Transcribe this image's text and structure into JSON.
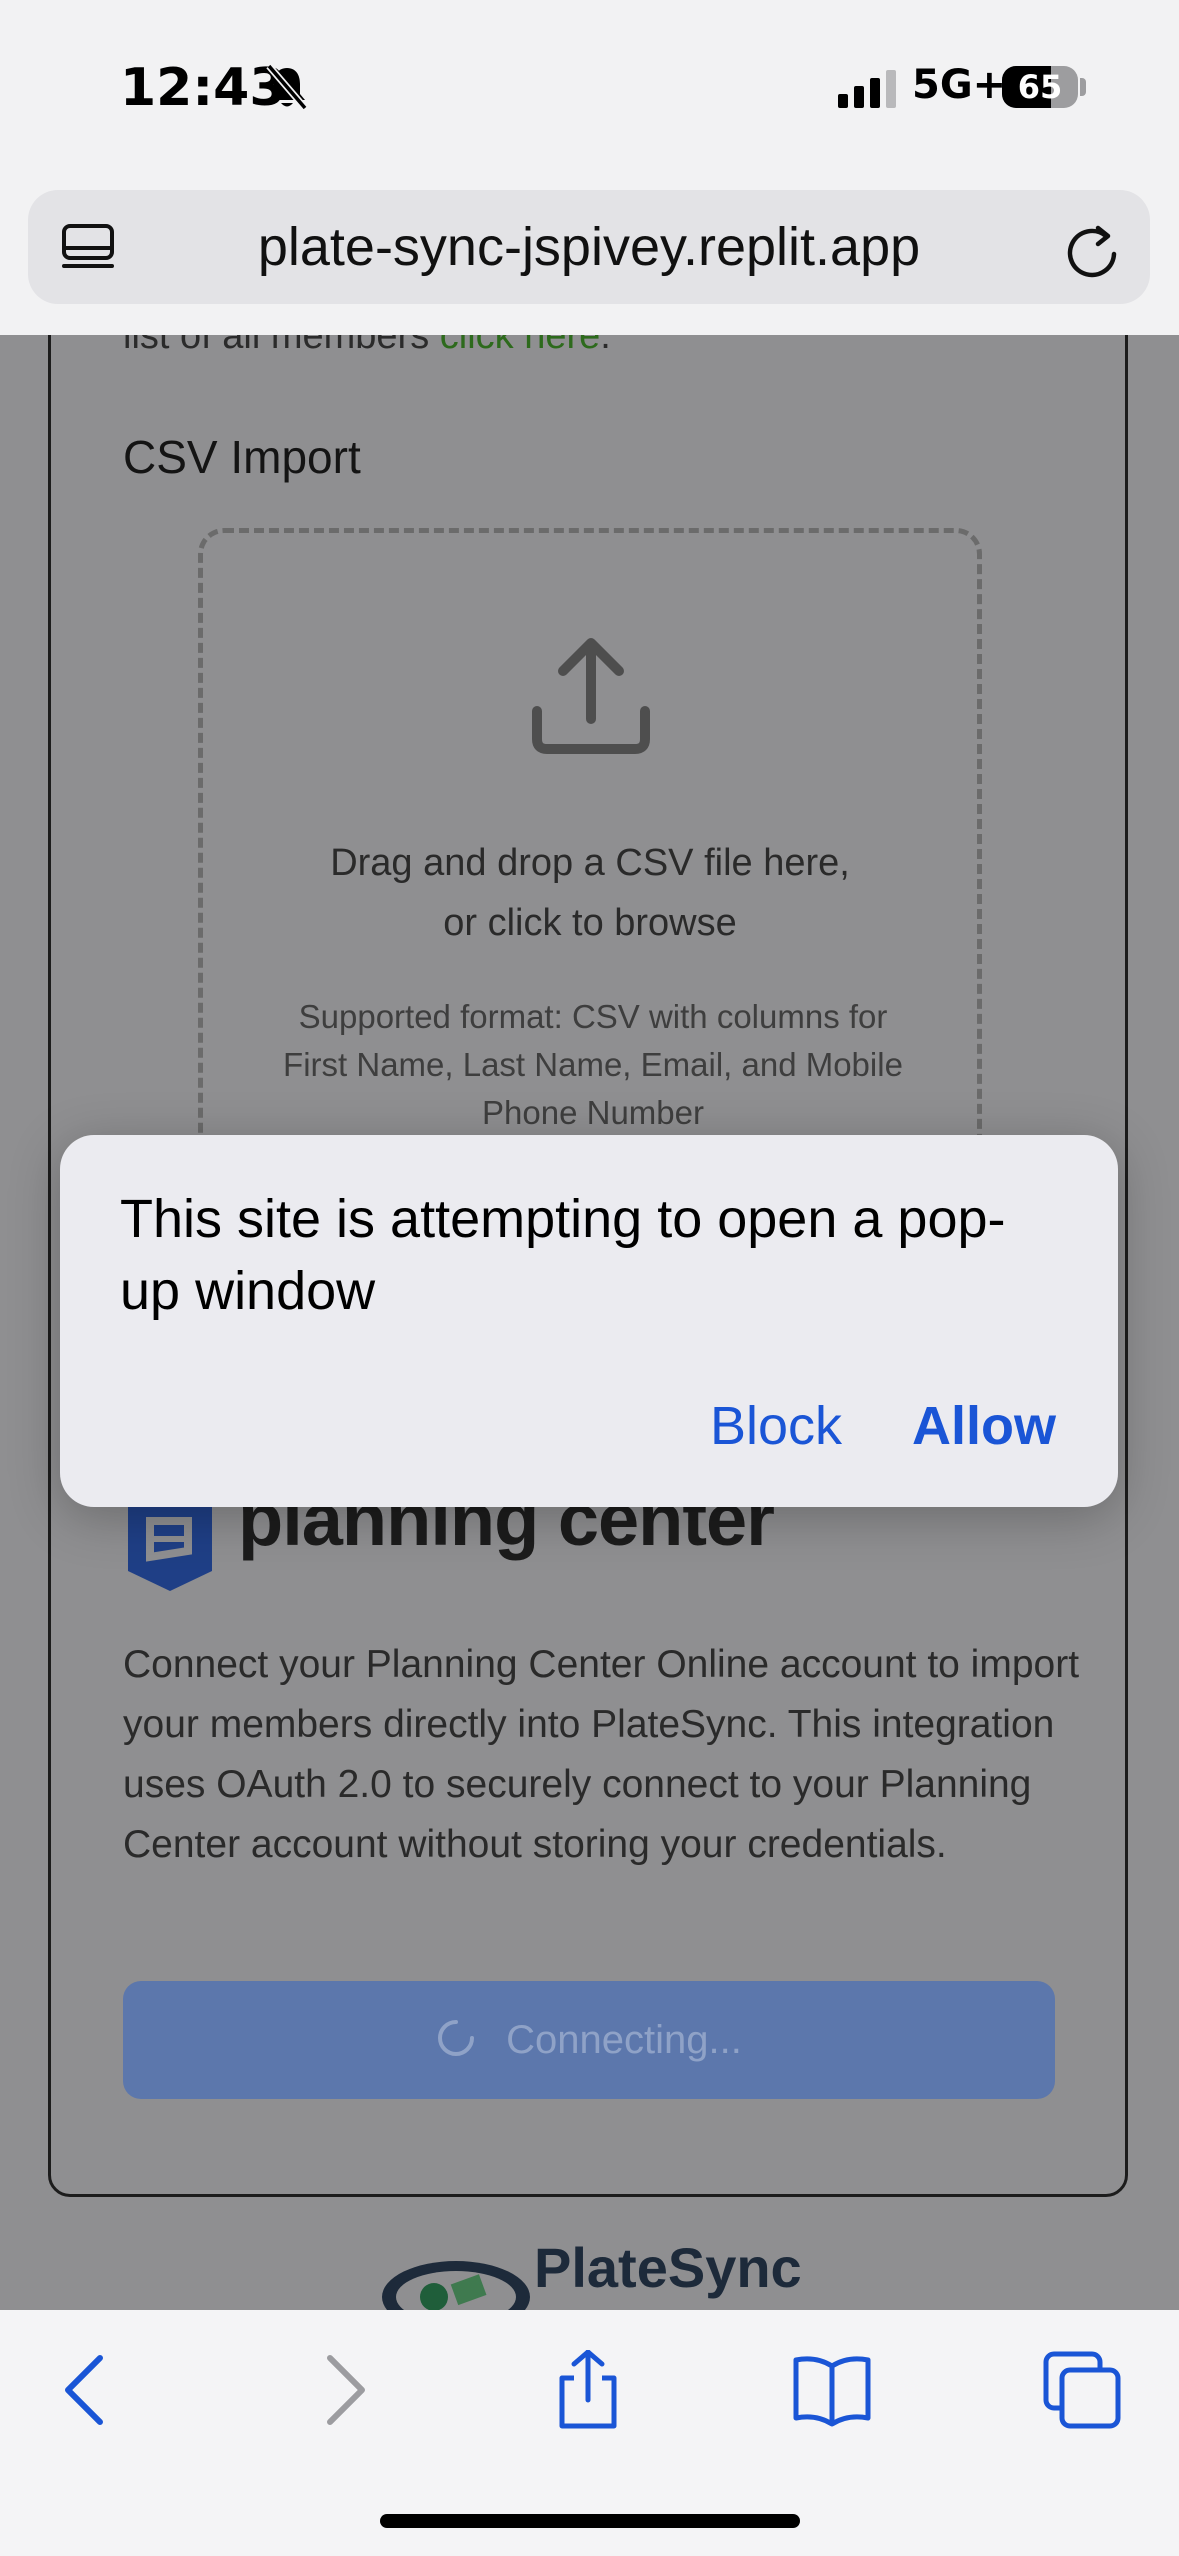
{
  "status_bar": {
    "time": "12:43",
    "network": "5G+",
    "battery": "65",
    "battery_level": 0.65
  },
  "browser": {
    "url": "plate-sync-jspivey.replit.app"
  },
  "page": {
    "intro_text": "list of all members ",
    "intro_link": "click here",
    "intro_end": ".",
    "csv_title": "CSV Import",
    "drop_line1": "Drag and drop a CSV file here,",
    "drop_line2": "or click to browse",
    "drop_sub": "Supported format: CSV with columns for First Name, Last Name, Email, and Mobile Phone Number",
    "pc_logo_text": "planning center",
    "pc_description": "Connect your Planning Center Online account to import your members directly into PlateSync. This integration uses OAuth 2.0 to securely connect to your Planning Center account without storing your credentials.",
    "connect_button": "Connecting...",
    "footer_logo": "PlateSync"
  },
  "popup": {
    "message": "This site is attempting to open a pop-up window",
    "block_label": "Block",
    "allow_label": "Allow"
  },
  "colors": {
    "accent": "#1a55d6",
    "link_green": "#2d6a1c",
    "button_bg": "#5c77ac"
  },
  "icons": {
    "tabs": "tabs-icon",
    "reload": "reload-icon",
    "upload": "upload-icon",
    "back": "back-icon",
    "forward": "forward-icon",
    "share": "share-icon",
    "bookmarks": "bookmarks-icon",
    "tab_overview": "tab-overview-icon"
  }
}
